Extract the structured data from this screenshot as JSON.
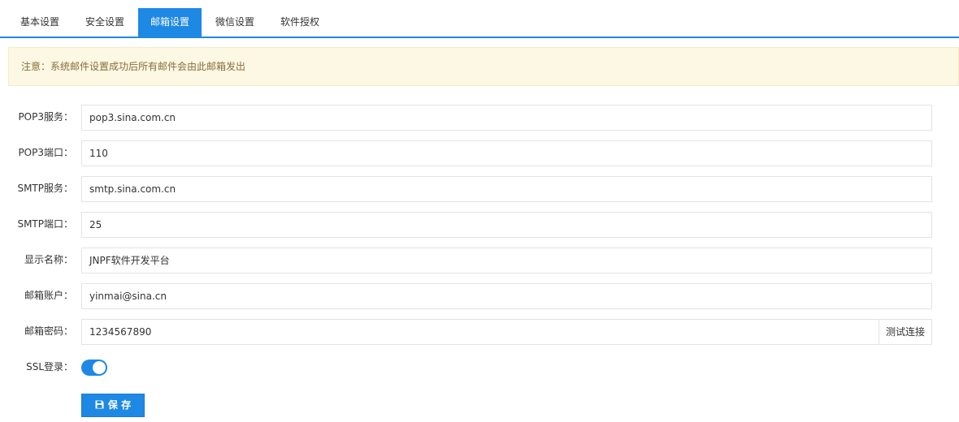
{
  "tabs": [
    {
      "label": "基本设置"
    },
    {
      "label": "安全设置"
    },
    {
      "label": "邮箱设置"
    },
    {
      "label": "微信设置"
    },
    {
      "label": "软件授权"
    }
  ],
  "active_tab": "邮箱设置",
  "notice": "注意：系统邮件设置成功后所有邮件会由此邮箱发出",
  "form": {
    "pop3_server": {
      "label": "POP3服务：",
      "value": "pop3.sina.com.cn"
    },
    "pop3_port": {
      "label": "POP3端口：",
      "value": "110"
    },
    "smtp_server": {
      "label": "SMTP服务：",
      "value": "smtp.sina.com.cn"
    },
    "smtp_port": {
      "label": "SMTP端口：",
      "value": "25"
    },
    "display_name": {
      "label": "显示名称：",
      "value": "JNPF软件开发平台"
    },
    "account": {
      "label": "邮箱账户：",
      "value": "yinmai@sina.cn"
    },
    "password": {
      "label": "邮箱密码：",
      "value": "1234567890",
      "addon_label": "测试连接"
    },
    "ssl": {
      "label": "SSL登录：",
      "enabled": true
    }
  },
  "save_label": "保 存",
  "colors": {
    "accent": "#1e88e5",
    "notice_bg": "#fcf8e3",
    "notice_text": "#8a6d3b"
  },
  "icons": {
    "save": "floppy-disk-icon"
  }
}
